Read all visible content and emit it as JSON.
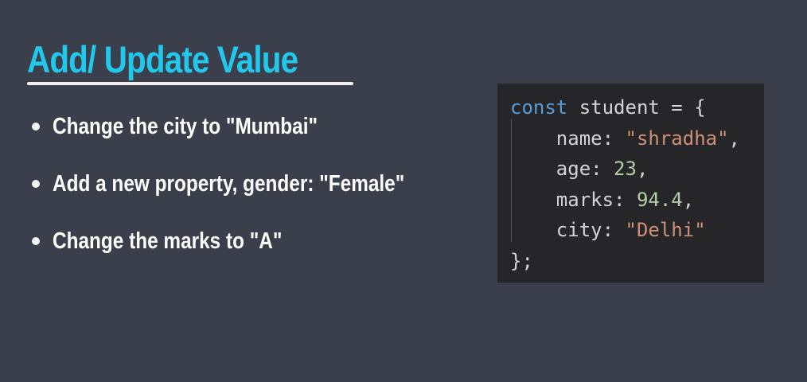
{
  "slide": {
    "title": "Add/ Update Value",
    "bullets": [
      "Change the city to \"Mumbai\"",
      "Add a new property, gender: \"Female\"",
      "Change the marks to \"A\""
    ]
  },
  "code": {
    "lines": [
      [
        {
          "t": "const",
          "c": "kw"
        },
        {
          "t": " student = {",
          "c": "id"
        }
      ],
      [
        {
          "t": "    name: ",
          "c": "id"
        },
        {
          "t": "\"shradha\"",
          "c": "str"
        },
        {
          "t": ",",
          "c": "id"
        }
      ],
      [
        {
          "t": "    age: ",
          "c": "id"
        },
        {
          "t": "23",
          "c": "num"
        },
        {
          "t": ",",
          "c": "id"
        }
      ],
      [
        {
          "t": "    marks: ",
          "c": "id"
        },
        {
          "t": "94.4",
          "c": "num"
        },
        {
          "t": ",",
          "c": "id"
        }
      ],
      [
        {
          "t": "    city: ",
          "c": "id"
        },
        {
          "t": "\"Delhi\"",
          "c": "str"
        }
      ],
      [
        {
          "t": "};",
          "c": "id"
        }
      ]
    ]
  },
  "colors": {
    "background": "#3a3f4b",
    "title": "#22c8ec",
    "code_background": "#262629",
    "keyword": "#569cd6",
    "string": "#ce9178",
    "number": "#b5cea8"
  }
}
